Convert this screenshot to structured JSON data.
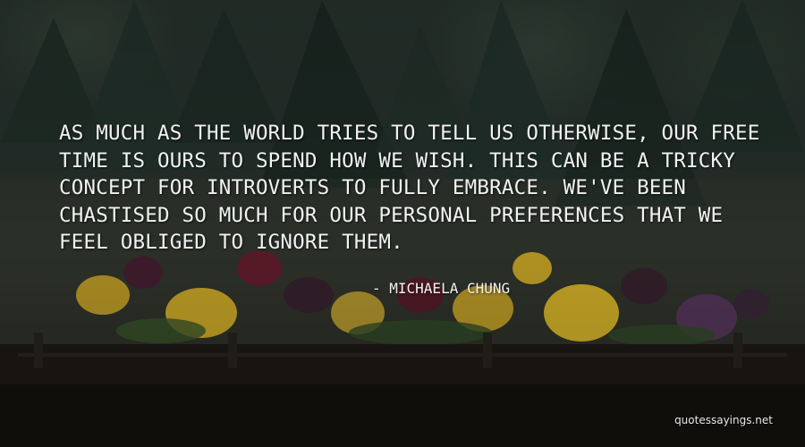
{
  "quote": {
    "text": "AS MUCH AS THE WORLD TRIES TO TELL US OTHERWISE, OUR FREE TIME IS OURS TO SPEND HOW WE WISH. THIS CAN BE A TRICKY CONCEPT FOR INTROVERTS TO FULLY EMBRACE. WE'VE BEEN CHASTISED SO MUCH FOR OUR PERSONAL PREFERENCES THAT WE FEEL OBLIGED TO IGNORE THEM.",
    "author": "- MICHAELA CHUNG"
  },
  "watermark": "quotessayings.net",
  "colors": {
    "text": "#f2f2f2",
    "tree": "#24332c",
    "flower_yellow": "#d8b32a",
    "flower_purple": "#4a2035",
    "planter": "#1e1a17"
  }
}
